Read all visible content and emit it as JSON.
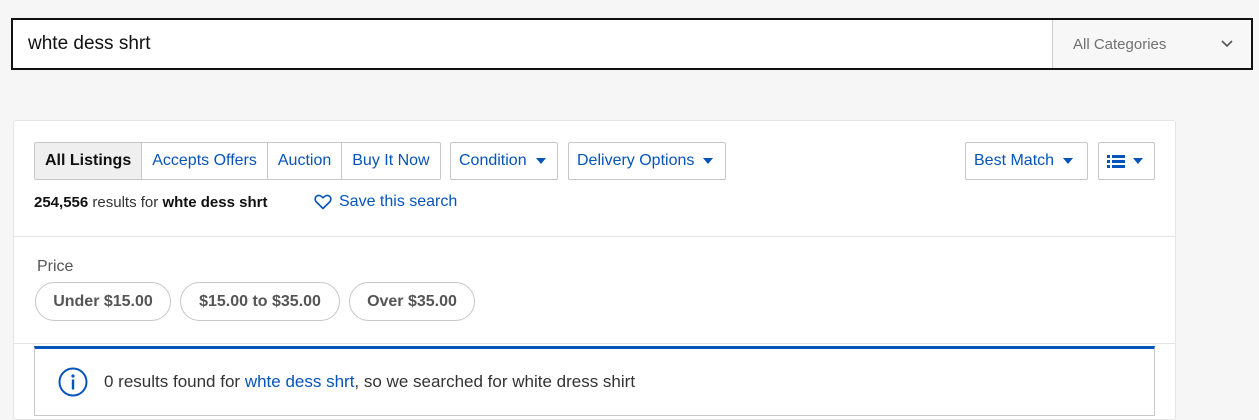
{
  "search": {
    "query": "whte dess shrt",
    "category": "All Categories"
  },
  "filters": {
    "tabs": [
      {
        "label": "All Listings",
        "active": true
      },
      {
        "label": "Accepts Offers",
        "active": false
      },
      {
        "label": "Auction",
        "active": false
      },
      {
        "label": "Buy It Now",
        "active": false
      }
    ],
    "condition_label": "Condition",
    "delivery_label": "Delivery Options",
    "sort_label": "Best Match"
  },
  "results": {
    "count": "254,556",
    "results_for_text": "results for",
    "query": "whte dess shrt",
    "save_label": "Save this search"
  },
  "price": {
    "label": "Price",
    "chips": [
      "Under $15.00",
      "$15.00 to $35.00",
      "Over $35.00"
    ]
  },
  "notice": {
    "prefix": "0 results found for",
    "keyword": "whte dess shrt",
    "suffix": ", so we searched for white dress shirt"
  },
  "colors": {
    "link": "#0654ba",
    "background": "#f6f6f6"
  },
  "icons": [
    "chevron-down-icon",
    "caret-down-icon",
    "heart-icon",
    "list-view-icon",
    "info-icon"
  ]
}
